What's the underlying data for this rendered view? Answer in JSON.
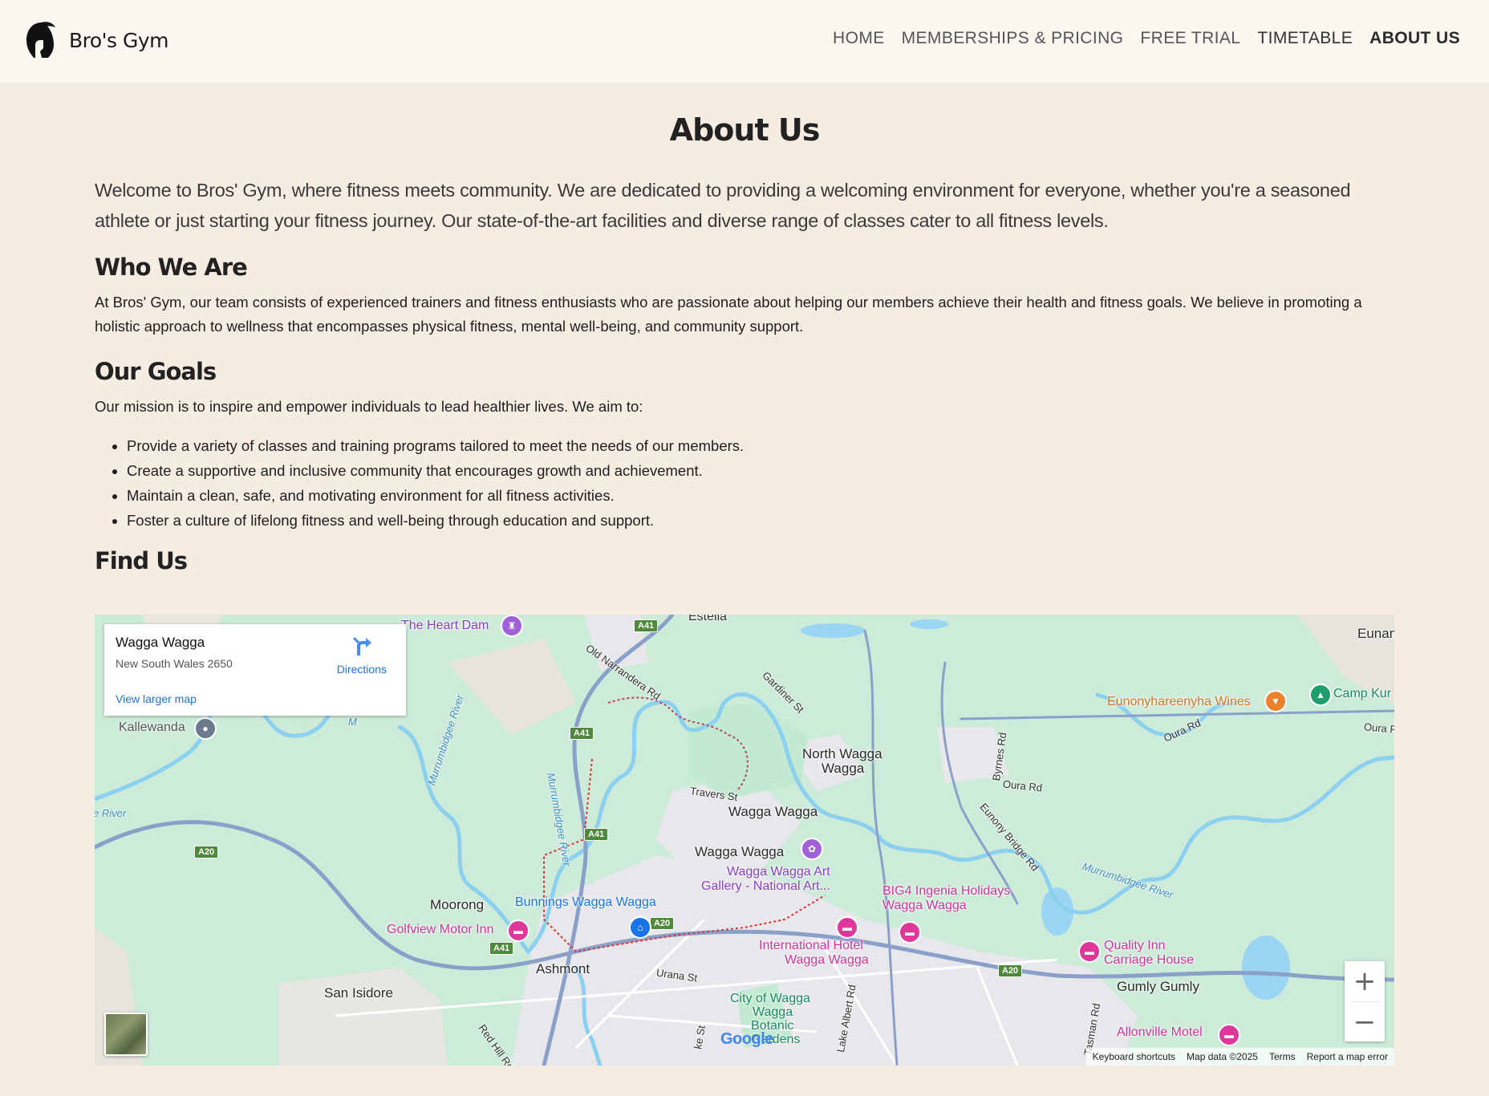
{
  "site": {
    "name": "Bro's Gym"
  },
  "nav": [
    {
      "label": "HOME"
    },
    {
      "label": "MEMBERSHIPS & PRICING"
    },
    {
      "label": "FREE TRIAL"
    },
    {
      "label": "TIMETABLE"
    },
    {
      "label": "ABOUT US"
    }
  ],
  "page": {
    "title": "About Us",
    "intro": "Welcome to Bros' Gym, where fitness meets community. We are dedicated to providing a welcoming environment for everyone, whether you're a seasoned athlete or just starting your fitness journey. Our state-of-the-art facilities and diverse range of classes cater to all fitness levels.",
    "who": {
      "heading": "Who We Are",
      "text": "At Bros' Gym, our team consists of experienced trainers and fitness enthusiasts who are passionate about helping our members achieve their health and fitness goals. We believe in promoting a holistic approach to wellness that encompasses physical fitness, mental well-being, and community support."
    },
    "goals": {
      "heading": "Our Goals",
      "text": "Our mission is to inspire and empower individuals to lead healthier lives. We aim to:",
      "items": [
        "Provide a variety of classes and training programs tailored to meet the needs of our members.",
        "Create a supportive and inclusive community that encourages growth and achievement.",
        "Maintain a clean, safe, and motivating environment for all fitness activities.",
        "Foster a culture of lifelong fitness and well-being through education and support."
      ]
    },
    "find": {
      "heading": "Find Us"
    }
  },
  "map": {
    "card": {
      "title": "Wagga Wagga",
      "address": "New South Wales 2650",
      "directions": "Directions",
      "larger_map": "View larger map"
    },
    "labels": {
      "estella": "Estella",
      "heart_dam": "The Heart Dam",
      "kallewanda": "Kallewanda",
      "old_narrandera": "Old Narrandera Rd",
      "gardiner": "Gardiner St",
      "north_wagga": "North Wagga",
      "north_wagga2": "Wagga",
      "travers": "Travers St",
      "wagga1": "Wagga Wagga",
      "wagga2": "Wagga Wagga",
      "art_gallery1": "Wagga Wagga Art",
      "art_gallery2": "Gallery - National Art...",
      "moorong": "Moorong",
      "bunnings": "Bunnings Wagga Wagga",
      "golfview": "Golfview Motor Inn",
      "ashmont": "Ashmont",
      "san_isidore": "San Isidore",
      "urana": "Urana St",
      "red_hill": "Red Hill Rd",
      "international1": "International Hotel",
      "international2": "Wagga Wagga",
      "botanic1": "City of Wagga",
      "botanic2": "Wagga",
      "botanic3": "Botanic",
      "botanic4": "Gardens",
      "lake_albert": "Lake Albert Rd",
      "big4_1": "BIG4 Ingenia Holidays",
      "big4_2": "Wagga Wagga",
      "quality1": "Quality Inn",
      "quality2": "Carriage House",
      "gumly": "Gumly Gumly",
      "tasman": "Tasman Rd",
      "allonville": "Allonville Motel",
      "eunanoreenya": "Eunanoree",
      "eunonyhareenyha": "Eunonyhareenyha Wines",
      "camp_kur": "Camp Kur",
      "oura_rd1": "Oura Rd",
      "oura_rd2": "Oura Rd",
      "oura_rd3": "Oura R",
      "byrnes": "Byrnes Rd",
      "eunony_bridge": "Eunony Bridge Rd",
      "murrumbidgee1": "Murrumbidgee River",
      "murrumbidgee2": "Murrumbidgee River",
      "murrumbidgee3": "Murrumbidgee River",
      "river_left": "e River",
      "ke_st": "ke St",
      "mu": "M"
    },
    "shields": {
      "a41a": "A41",
      "a41b": "A41",
      "a41c": "A41",
      "a41d": "A41",
      "a20a": "A20",
      "a20b": "A20",
      "a20c": "A20"
    },
    "google": "Google",
    "attribution": {
      "shortcuts": "Keyboard shortcuts",
      "data": "Map data ©2025",
      "terms": "Terms",
      "report": "Report a map error"
    },
    "zoom_in": "+",
    "zoom_out": "−"
  },
  "colors": {
    "page_bg": "#f6ece2",
    "header_bg": "#faf7f0",
    "map_green": "#cdebd9",
    "link_blue": "#1a73e8"
  }
}
